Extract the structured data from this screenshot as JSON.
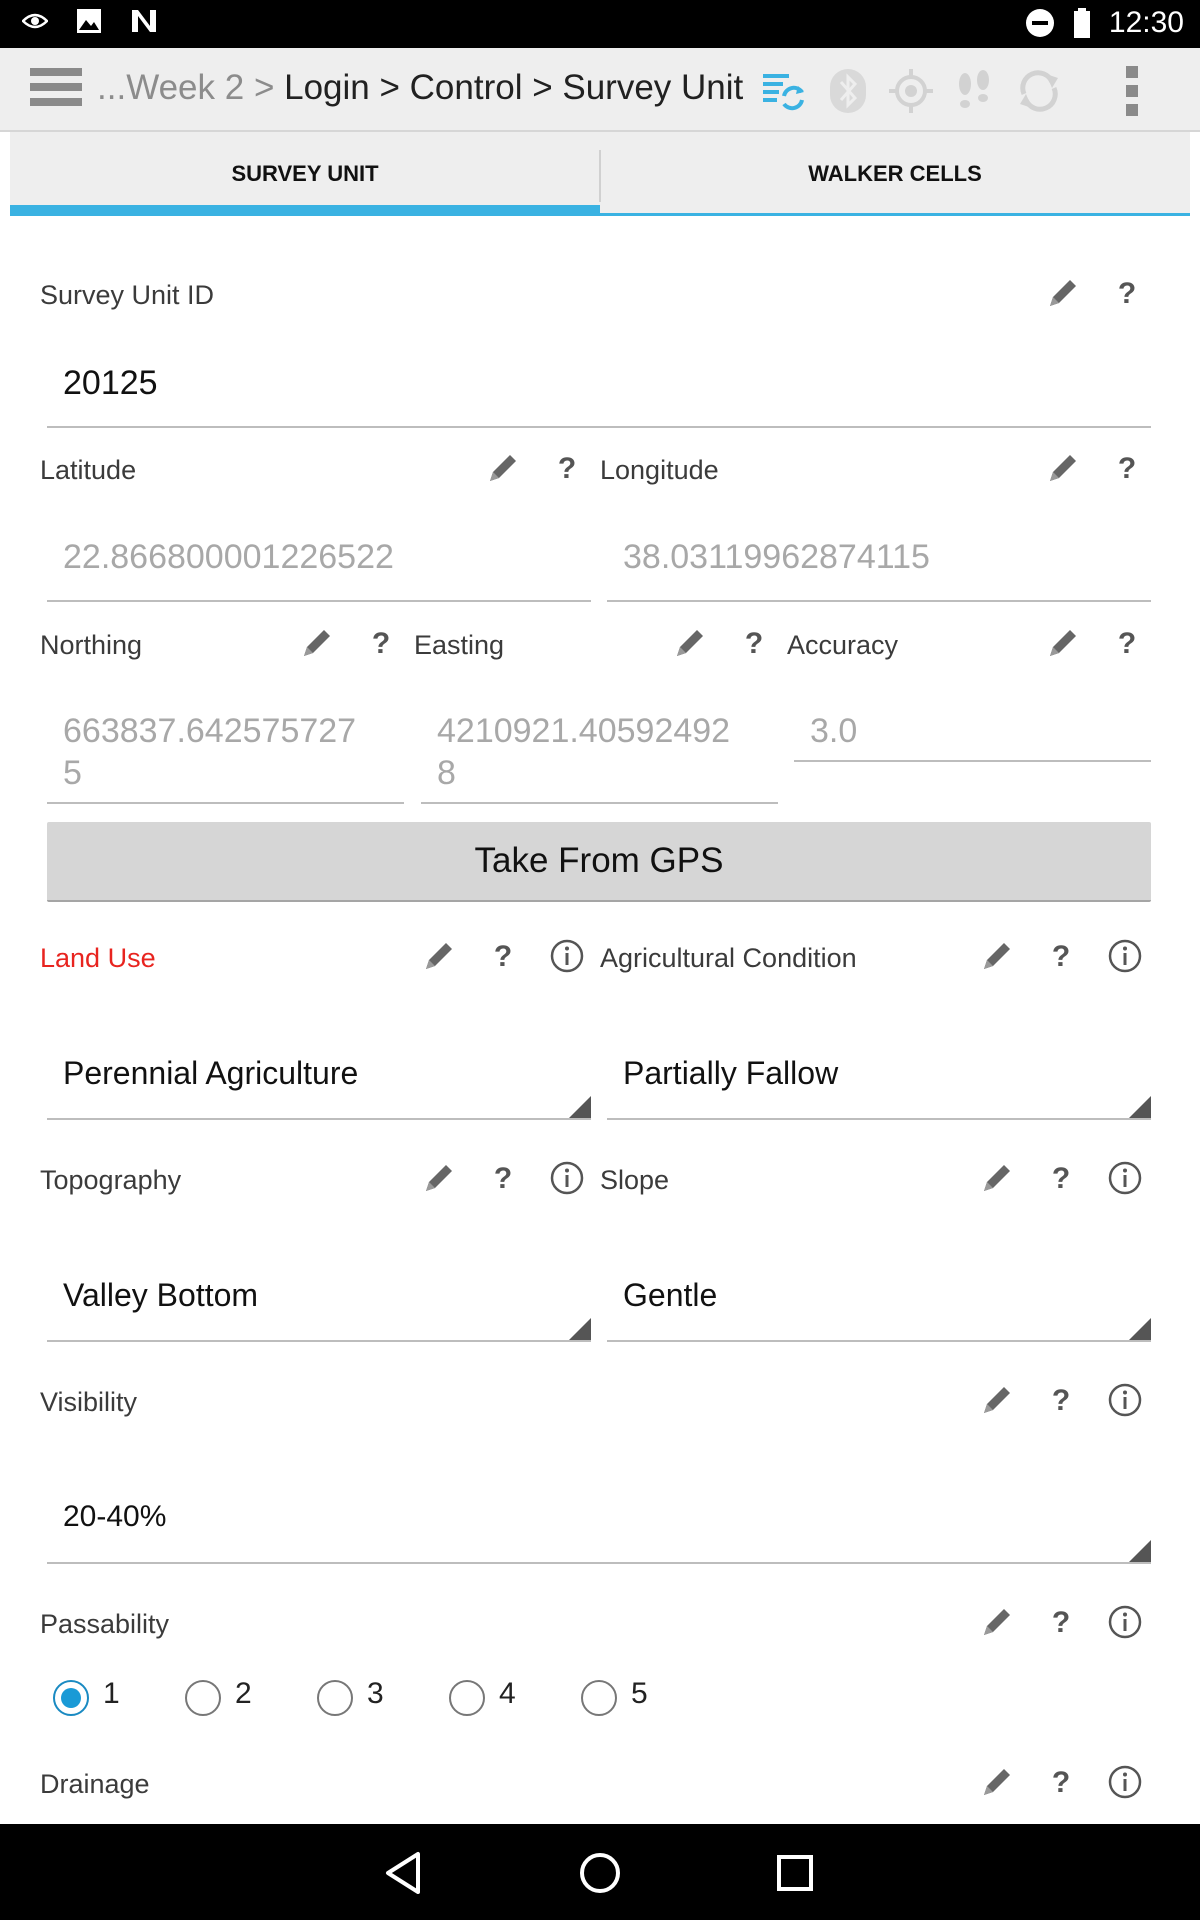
{
  "status_bar": {
    "time": "12:30",
    "left_icons": [
      "eye-icon",
      "image-icon",
      "n-logo-icon"
    ],
    "right_icons": [
      "do-not-disturb-icon",
      "battery-icon"
    ]
  },
  "action_bar": {
    "breadcrumb": {
      "ellipsis": "...",
      "items": [
        "Week 2",
        "Login",
        "Control",
        "Survey Unit"
      ],
      "separator": " > "
    },
    "icons": [
      "sync-data-icon",
      "bluetooth-icon",
      "gps-icon",
      "tracker-icon",
      "refresh-icon",
      "overflow-menu-icon"
    ],
    "accent_color": "#3ab2e2"
  },
  "tabs": [
    {
      "label": "SURVEY UNIT",
      "active": true
    },
    {
      "label": "WALKER CELLS",
      "active": false
    }
  ],
  "form": {
    "survey_unit_id": {
      "label": "Survey Unit ID",
      "value": "20125"
    },
    "latitude": {
      "label": "Latitude",
      "placeholder": "22.866800001226522"
    },
    "longitude": {
      "label": "Longitude",
      "placeholder": "38.03119962874115"
    },
    "northing": {
      "label": "Northing",
      "placeholder": "663837.642575727\n5"
    },
    "easting": {
      "label": "Easting",
      "placeholder": "4210921.40592492\n8"
    },
    "accuracy": {
      "label": "Accuracy",
      "placeholder": "3.0"
    },
    "gps_button": "Take From GPS",
    "land_use": {
      "label": "Land Use",
      "value": "Perennial Agriculture",
      "label_color": "#e8241f"
    },
    "agricultural_condition": {
      "label": "Agricultural Condition",
      "value": "Partially Fallow"
    },
    "topography": {
      "label": "Topography",
      "value": "Valley Bottom"
    },
    "slope": {
      "label": "Slope",
      "value": "Gentle"
    },
    "visibility": {
      "label": "Visibility",
      "value": "20-40%"
    },
    "passability": {
      "label": "Passability",
      "options": [
        "1",
        "2",
        "3",
        "4",
        "5"
      ],
      "selected": "1"
    },
    "drainage": {
      "label": "Drainage"
    },
    "question_mark": "?"
  },
  "nav_bar": {
    "icons": [
      "back-icon",
      "home-icon",
      "recents-icon"
    ]
  }
}
